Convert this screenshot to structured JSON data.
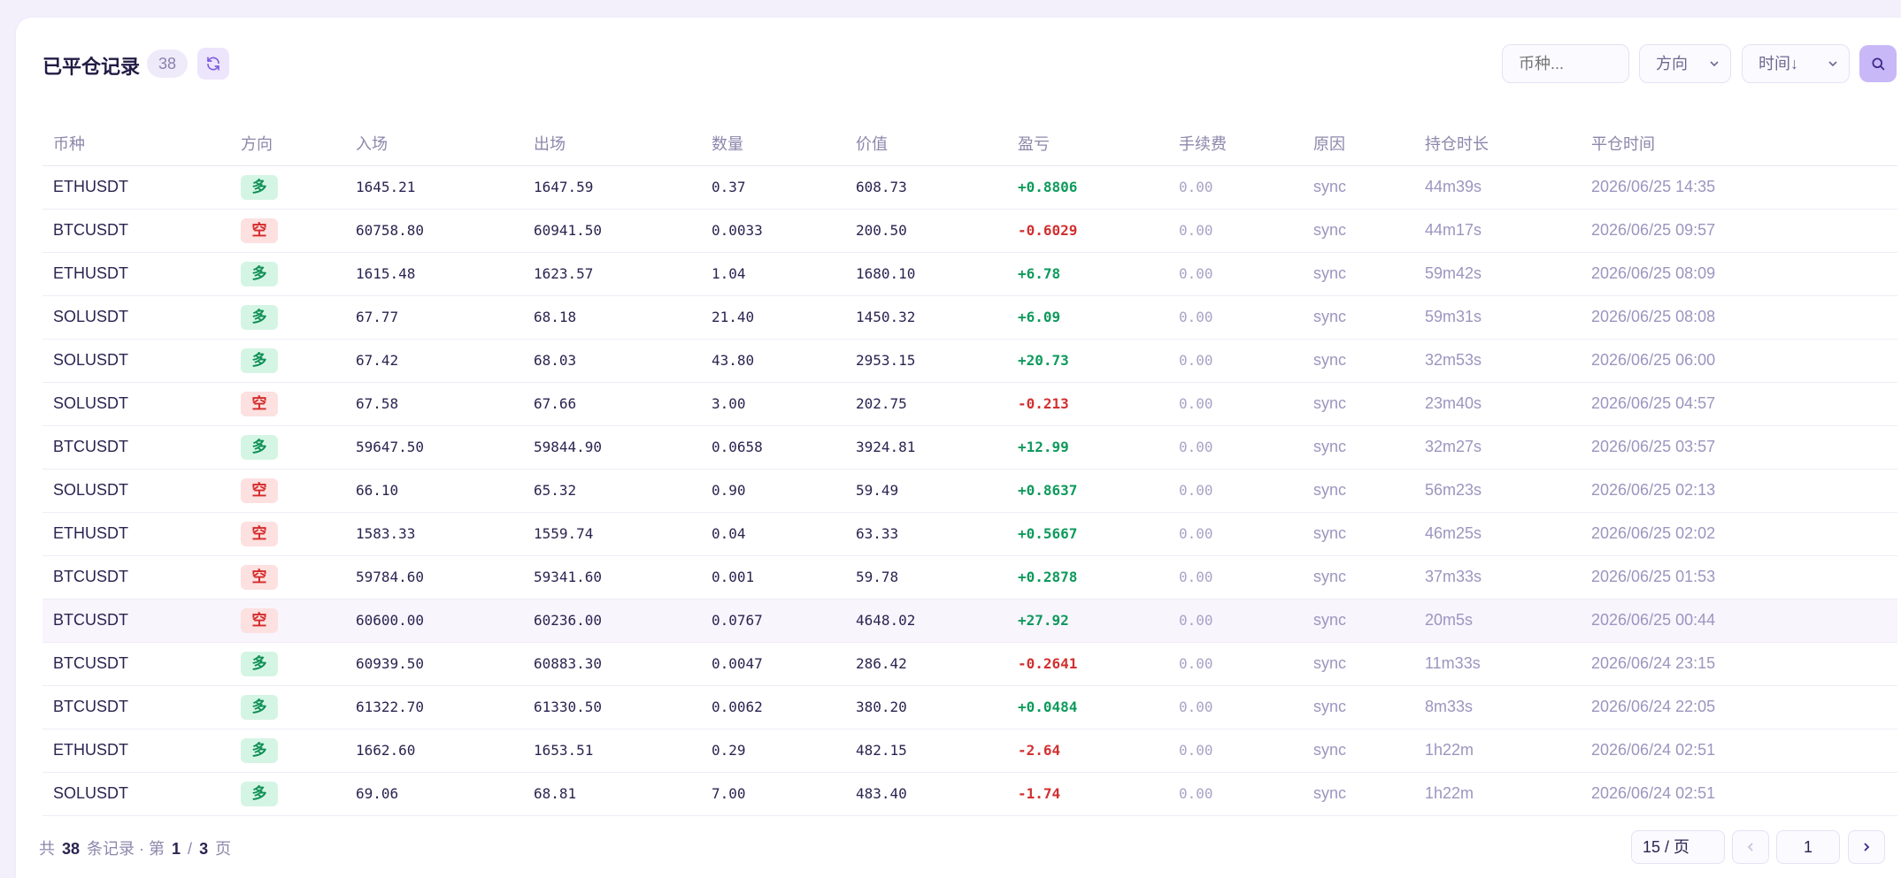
{
  "header": {
    "title": "已平仓记录",
    "count": "38",
    "symbol_placeholder": "币种...",
    "direction_label": "方向",
    "time_sort_label": "时间↓"
  },
  "columns": [
    "币种",
    "方向",
    "入场",
    "出场",
    "数量",
    "价值",
    "盈亏",
    "手续费",
    "原因",
    "持仓时长",
    "平仓时间"
  ],
  "rows": [
    {
      "symbol": "ETHUSDT",
      "side": "多",
      "side_type": "long",
      "entry": "1645.21",
      "exit": "1647.59",
      "qty": "0.37",
      "value": "608.73",
      "pnl": "+0.8806",
      "pnl_sign": "pos",
      "fee": "0.00",
      "reason": "sync",
      "duration": "44m39s",
      "closed": "2026/06/25 14:35"
    },
    {
      "symbol": "BTCUSDT",
      "side": "空",
      "side_type": "short",
      "entry": "60758.80",
      "exit": "60941.50",
      "qty": "0.0033",
      "value": "200.50",
      "pnl": "-0.6029",
      "pnl_sign": "neg",
      "fee": "0.00",
      "reason": "sync",
      "duration": "44m17s",
      "closed": "2026/06/25 09:57"
    },
    {
      "symbol": "ETHUSDT",
      "side": "多",
      "side_type": "long",
      "entry": "1615.48",
      "exit": "1623.57",
      "qty": "1.04",
      "value": "1680.10",
      "pnl": "+6.78",
      "pnl_sign": "pos",
      "fee": "0.00",
      "reason": "sync",
      "duration": "59m42s",
      "closed": "2026/06/25 08:09"
    },
    {
      "symbol": "SOLUSDT",
      "side": "多",
      "side_type": "long",
      "entry": "67.77",
      "exit": "68.18",
      "qty": "21.40",
      "value": "1450.32",
      "pnl": "+6.09",
      "pnl_sign": "pos",
      "fee": "0.00",
      "reason": "sync",
      "duration": "59m31s",
      "closed": "2026/06/25 08:08"
    },
    {
      "symbol": "SOLUSDT",
      "side": "多",
      "side_type": "long",
      "entry": "67.42",
      "exit": "68.03",
      "qty": "43.80",
      "value": "2953.15",
      "pnl": "+20.73",
      "pnl_sign": "pos",
      "fee": "0.00",
      "reason": "sync",
      "duration": "32m53s",
      "closed": "2026/06/25 06:00"
    },
    {
      "symbol": "SOLUSDT",
      "side": "空",
      "side_type": "short",
      "entry": "67.58",
      "exit": "67.66",
      "qty": "3.00",
      "value": "202.75",
      "pnl": "-0.213",
      "pnl_sign": "neg",
      "fee": "0.00",
      "reason": "sync",
      "duration": "23m40s",
      "closed": "2026/06/25 04:57"
    },
    {
      "symbol": "BTCUSDT",
      "side": "多",
      "side_type": "long",
      "entry": "59647.50",
      "exit": "59844.90",
      "qty": "0.0658",
      "value": "3924.81",
      "pnl": "+12.99",
      "pnl_sign": "pos",
      "fee": "0.00",
      "reason": "sync",
      "duration": "32m27s",
      "closed": "2026/06/25 03:57"
    },
    {
      "symbol": "SOLUSDT",
      "side": "空",
      "side_type": "short",
      "entry": "66.10",
      "exit": "65.32",
      "qty": "0.90",
      "value": "59.49",
      "pnl": "+0.8637",
      "pnl_sign": "pos",
      "fee": "0.00",
      "reason": "sync",
      "duration": "56m23s",
      "closed": "2026/06/25 02:13"
    },
    {
      "symbol": "ETHUSDT",
      "side": "空",
      "side_type": "short",
      "entry": "1583.33",
      "exit": "1559.74",
      "qty": "0.04",
      "value": "63.33",
      "pnl": "+0.5667",
      "pnl_sign": "pos",
      "fee": "0.00",
      "reason": "sync",
      "duration": "46m25s",
      "closed": "2026/06/25 02:02"
    },
    {
      "symbol": "BTCUSDT",
      "side": "空",
      "side_type": "short",
      "entry": "59784.60",
      "exit": "59341.60",
      "qty": "0.001",
      "value": "59.78",
      "pnl": "+0.2878",
      "pnl_sign": "pos",
      "fee": "0.00",
      "reason": "sync",
      "duration": "37m33s",
      "closed": "2026/06/25 01:53"
    },
    {
      "symbol": "BTCUSDT",
      "side": "空",
      "side_type": "short",
      "entry": "60600.00",
      "exit": "60236.00",
      "qty": "0.0767",
      "value": "4648.02",
      "pnl": "+27.92",
      "pnl_sign": "pos",
      "fee": "0.00",
      "reason": "sync",
      "duration": "20m5s",
      "closed": "2026/06/25 00:44",
      "highlight": true
    },
    {
      "symbol": "BTCUSDT",
      "side": "多",
      "side_type": "long",
      "entry": "60939.50",
      "exit": "60883.30",
      "qty": "0.0047",
      "value": "286.42",
      "pnl": "-0.2641",
      "pnl_sign": "neg",
      "fee": "0.00",
      "reason": "sync",
      "duration": "11m33s",
      "closed": "2026/06/24 23:15"
    },
    {
      "symbol": "BTCUSDT",
      "side": "多",
      "side_type": "long",
      "entry": "61322.70",
      "exit": "61330.50",
      "qty": "0.0062",
      "value": "380.20",
      "pnl": "+0.0484",
      "pnl_sign": "pos",
      "fee": "0.00",
      "reason": "sync",
      "duration": "8m33s",
      "closed": "2026/06/24 22:05"
    },
    {
      "symbol": "ETHUSDT",
      "side": "多",
      "side_type": "long",
      "entry": "1662.60",
      "exit": "1653.51",
      "qty": "0.29",
      "value": "482.15",
      "pnl": "-2.64",
      "pnl_sign": "neg",
      "fee": "0.00",
      "reason": "sync",
      "duration": "1h22m",
      "closed": "2026/06/24 02:51"
    },
    {
      "symbol": "SOLUSDT",
      "side": "多",
      "side_type": "long",
      "entry": "69.06",
      "exit": "68.81",
      "qty": "7.00",
      "value": "483.40",
      "pnl": "-1.74",
      "pnl_sign": "neg",
      "fee": "0.00",
      "reason": "sync",
      "duration": "1h22m",
      "closed": "2026/06/24 02:51"
    }
  ],
  "footer": {
    "prefix": "共",
    "total": "38",
    "mid": "条记录 · 第",
    "page": "1",
    "sep": "/",
    "pages": "3",
    "suffix": "页",
    "page_size": "15 / 页",
    "page_input": "1"
  },
  "colors": {
    "accent": "#c8b8f7",
    "positive": "#0e9a5c",
    "negative": "#d23030",
    "long_bg": "#d5f5e4",
    "short_bg": "#fde0e0"
  }
}
